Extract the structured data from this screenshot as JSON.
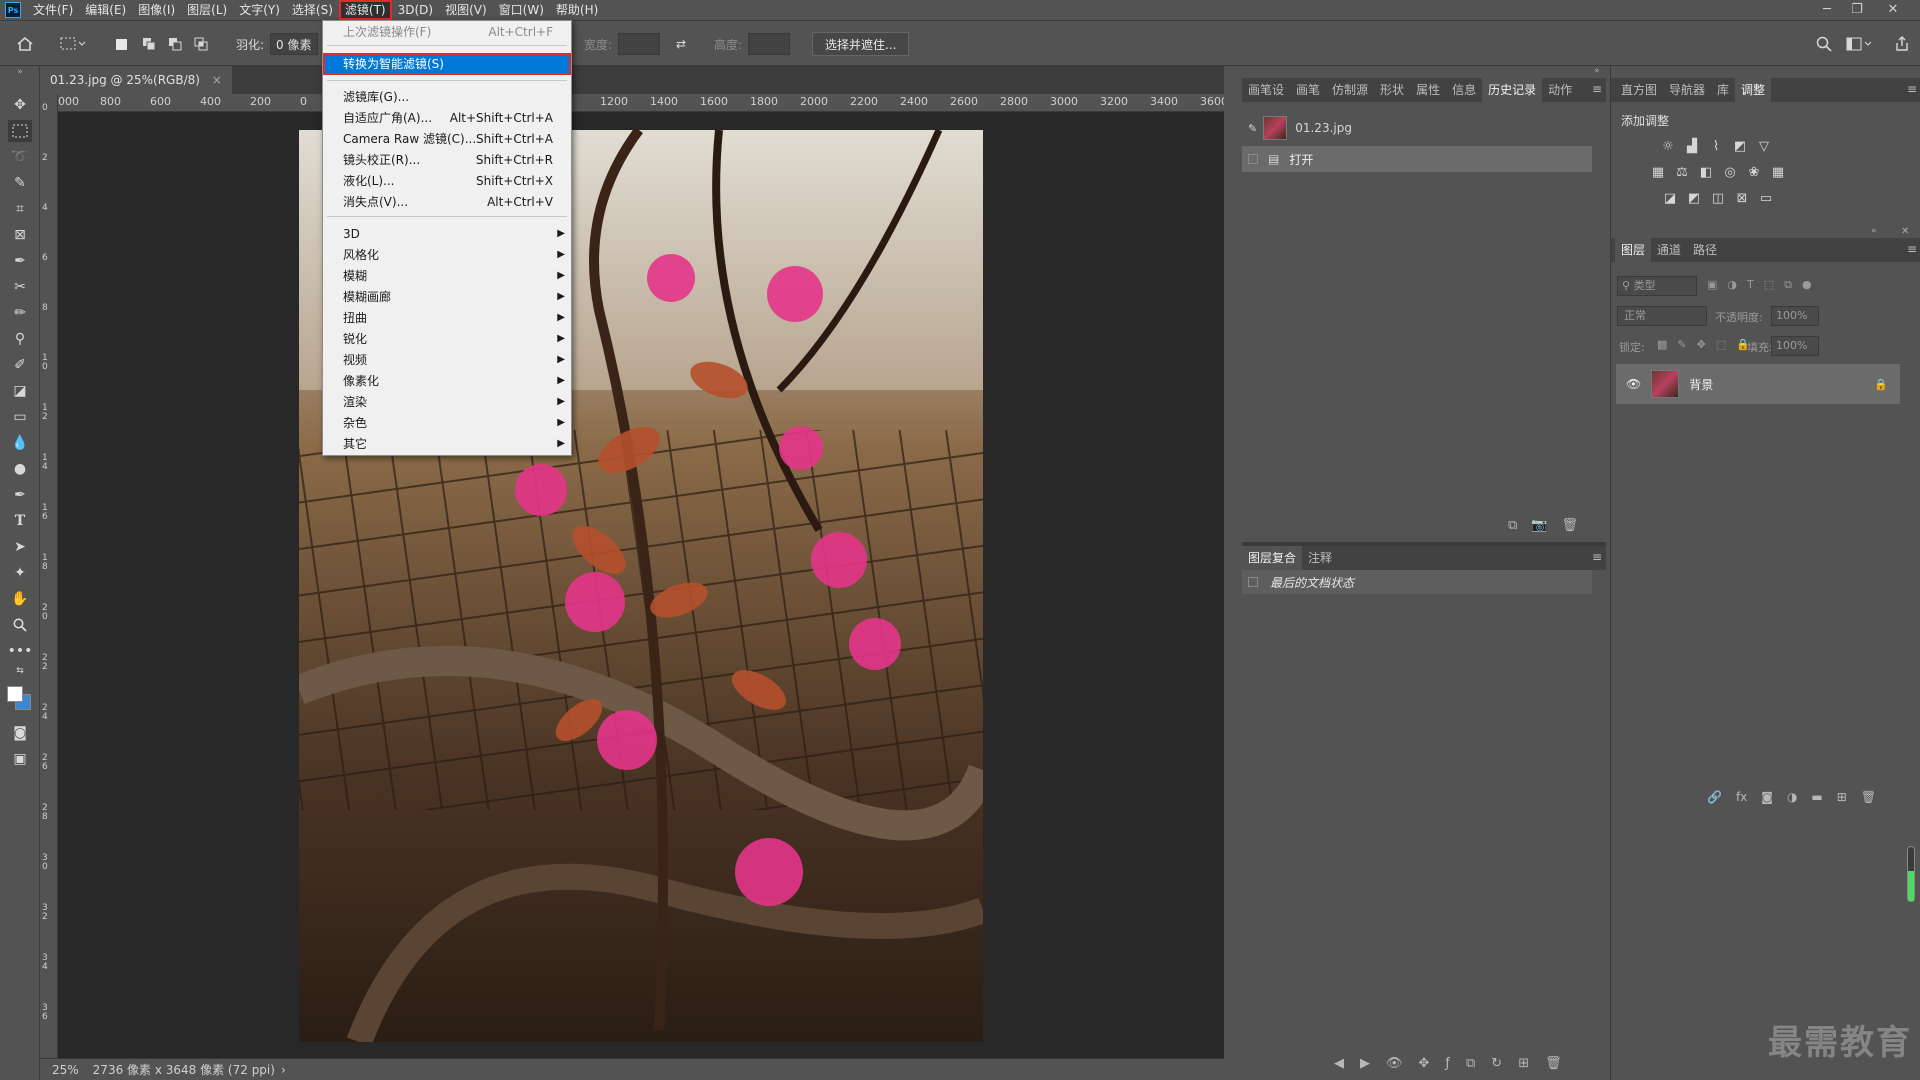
{
  "menubar": {
    "items": [
      "文件(F)",
      "编辑(E)",
      "图像(I)",
      "图层(L)",
      "文字(Y)",
      "选择(S)",
      "滤镜(T)",
      "3D(D)",
      "视图(V)",
      "窗口(W)",
      "帮助(H)"
    ],
    "active_index": 6
  },
  "optionsbar": {
    "feather_label": "羽化:",
    "feather_value": "0 像素",
    "width_label": "宽度:",
    "height_label": "高度:",
    "select_mask_button": "选择并遮住..."
  },
  "document": {
    "tab_title": "01.23.jpg @ 25%(RGB/8)",
    "tab_close": "×",
    "ruler_top": [
      "000",
      "800",
      "600",
      "400",
      "200",
      "0",
      "1200",
      "1400",
      "1600",
      "1800",
      "2000",
      "2200",
      "2400",
      "2600",
      "2800",
      "3000",
      "3200",
      "3400",
      "3600"
    ],
    "ruler_left": [
      "0",
      "2",
      "4",
      "6",
      "8",
      "1 0",
      "1 2",
      "1 4",
      "1 6",
      "1 8",
      "2 0",
      "2 2",
      "2 4",
      "2 6",
      "2 8",
      "3 0",
      "3 2",
      "3 4",
      "3 6"
    ],
    "zoom": "25%",
    "dimensions": "2736 像素 x 3648 像素 (72 ppi)",
    "status_arrow": "›"
  },
  "filter_menu": {
    "last_filter": {
      "label": "上次滤镜操作(F)",
      "shortcut": "Alt+Ctrl+F"
    },
    "convert_smart": {
      "label": "转换为智能滤镜(S)"
    },
    "items": [
      {
        "label": "滤镜库(G)...",
        "shortcut": ""
      },
      {
        "label": "自适应广角(A)...",
        "shortcut": "Alt+Shift+Ctrl+A"
      },
      {
        "label": "Camera Raw 滤镜(C)...",
        "shortcut": "Shift+Ctrl+A"
      },
      {
        "label": "镜头校正(R)...",
        "shortcut": "Shift+Ctrl+R"
      },
      {
        "label": "液化(L)...",
        "shortcut": "Shift+Ctrl+X"
      },
      {
        "label": "消失点(V)...",
        "shortcut": "Alt+Ctrl+V"
      }
    ],
    "submenus": [
      "3D",
      "风格化",
      "模糊",
      "模糊画廊",
      "扭曲",
      "锐化",
      "视频",
      "像素化",
      "渲染",
      "杂色",
      "其它"
    ]
  },
  "mid_panel": {
    "tabs": [
      "画笔设",
      "画笔",
      "仿制源",
      "形状",
      "属性",
      "信息",
      "历史记录",
      "动作"
    ],
    "active_tab": 6,
    "history_snapshot": "01.23.jpg",
    "history_items": [
      "打开"
    ],
    "comp_tabs": [
      "图层复合",
      "注释"
    ],
    "comp_item": "最后的文档状态"
  },
  "right_panel": {
    "top_tabs": [
      "直方图",
      "导航器",
      "库",
      "调整"
    ],
    "active_top_tab": 3,
    "add_adjustment": "添加调整",
    "layer_tabs": [
      "图层",
      "通道",
      "路径"
    ],
    "kind_label": "类型",
    "blend_mode": "正常",
    "opacity_label": "不透明度:",
    "opacity_value": "100%",
    "lock_label": "锁定:",
    "fill_label": "填充:",
    "fill_value": "100%",
    "layer_name": "背景"
  },
  "watermark": "最需教育",
  "colors": {
    "highlight": "#0078d7",
    "red_outline": "#e22b2b"
  }
}
